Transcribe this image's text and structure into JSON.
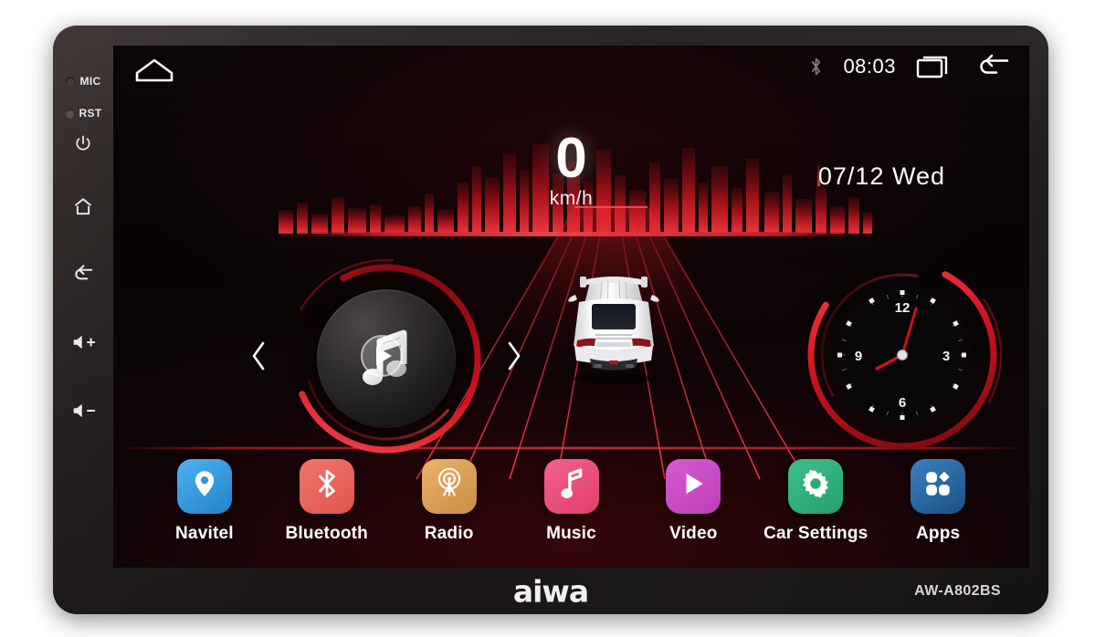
{
  "device": {
    "brand": "aiwa",
    "model": "AW-A802BS",
    "hardware_keys": [
      {
        "name": "mic",
        "label": "MIC",
        "icon": "dot-indicator"
      },
      {
        "name": "reset",
        "label": "RST",
        "icon": "dot-indicator"
      },
      {
        "name": "power",
        "label": "",
        "icon": "power-icon"
      },
      {
        "name": "home",
        "label": "",
        "icon": "home-icon"
      },
      {
        "name": "back",
        "label": "",
        "icon": "back-arrow-icon"
      },
      {
        "name": "volume-up",
        "label": "",
        "icon": "volume-up-icon"
      },
      {
        "name": "volume-down",
        "label": "",
        "icon": "volume-down-icon"
      }
    ]
  },
  "statusbar": {
    "home_icon": "home-outline-icon",
    "bluetooth_icon": "bluetooth-icon",
    "time": "08:03",
    "recents_icon": "recent-apps-icon",
    "back_icon": "back-arrow-icon"
  },
  "dashboard": {
    "speed_value": "0",
    "speed_unit": "km/h",
    "date": "07/12  Wed",
    "skyline_color": "#c4151e",
    "accent_color": "#e0252f",
    "music_widget": {
      "icon": "music-play-icon",
      "prev_icon": "chevron-left-icon",
      "next_icon": "chevron-right-icon"
    },
    "clock_widget": {
      "numerals": [
        "12",
        "3",
        "6",
        "9"
      ],
      "hour_hand_deg": 242,
      "minute_deg": 18,
      "second_deg": 18
    },
    "car_graphic": "white-sports-car-rear"
  },
  "dock": {
    "apps": [
      {
        "label": "Navitel",
        "icon": "map-pin-icon",
        "c1": "#4db3ef",
        "c2": "#2382cb"
      },
      {
        "label": "Bluetooth",
        "icon": "bluetooth-icon",
        "c1": "#f0776a",
        "c2": "#e0544e"
      },
      {
        "label": "Radio",
        "icon": "antenna-icon",
        "c1": "#e8b46a",
        "c2": "#cd8c44"
      },
      {
        "label": "Music",
        "icon": "music-note-icon",
        "c1": "#f0628c",
        "c2": "#e23f6e"
      },
      {
        "label": "Video",
        "icon": "play-icon",
        "c1": "#d65ad0",
        "c2": "#bb3fb8"
      },
      {
        "label": "Car Settings",
        "icon": "gear-icon",
        "c1": "#3fc08a",
        "c2": "#22a06b"
      },
      {
        "label": "Apps",
        "icon": "app-grid-icon",
        "c1": "#3a82c0",
        "c2": "#1c4f85"
      }
    ]
  }
}
